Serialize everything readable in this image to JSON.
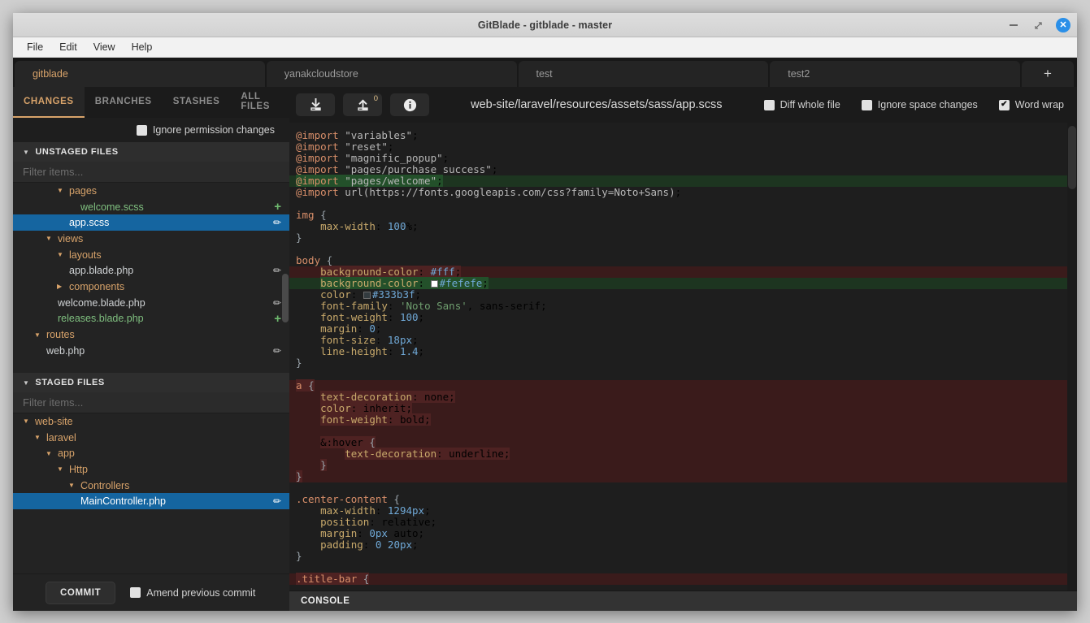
{
  "window": {
    "title": "GitBlade - gitblade - master",
    "minimize_label": "–",
    "maximize_label": "⤢",
    "close_label": "✕"
  },
  "menubar": {
    "items": [
      "File",
      "Edit",
      "View",
      "Help"
    ]
  },
  "repo_tabs": {
    "items": [
      {
        "label": "gitblade",
        "active": true
      },
      {
        "label": "yanakcloudstore",
        "active": false
      },
      {
        "label": "test",
        "active": false
      },
      {
        "label": "test2",
        "active": false
      }
    ],
    "add_label": "+"
  },
  "left_panel": {
    "tabs": [
      {
        "label": "CHANGES",
        "active": true
      },
      {
        "label": "BRANCHES",
        "active": false
      },
      {
        "label": "STASHES",
        "active": false
      },
      {
        "label": "ALL FILES",
        "active": false
      }
    ],
    "ignore_permission": {
      "label": "Ignore permission changes",
      "checked": false,
      "mark": ""
    },
    "unstaged": {
      "header": "UNSTAGED FILES",
      "filter_placeholder": "Filter items...",
      "rows": [
        {
          "label": "pages",
          "indent": 3,
          "type": "dir",
          "caret": "▾",
          "action": ""
        },
        {
          "label": "welcome.scss",
          "indent": 4,
          "type": "added",
          "caret": "",
          "action": "+"
        },
        {
          "label": "app.scss",
          "indent": 3,
          "type": "selected",
          "caret": "",
          "action": "✏"
        },
        {
          "label": "views",
          "indent": 2,
          "type": "dir",
          "caret": "▾",
          "action": ""
        },
        {
          "label": "layouts",
          "indent": 3,
          "type": "dir",
          "caret": "▾",
          "action": ""
        },
        {
          "label": "app.blade.php",
          "indent": 3,
          "type": "file",
          "caret": "",
          "action": "✏"
        },
        {
          "label": "components",
          "indent": 3,
          "type": "dir",
          "caret": "▸",
          "action": ""
        },
        {
          "label": "welcome.blade.php",
          "indent": 2,
          "type": "file",
          "caret": "",
          "action": "✏"
        },
        {
          "label": "releases.blade.php",
          "indent": 2,
          "type": "added",
          "caret": "",
          "action": "+"
        },
        {
          "label": "routes",
          "indent": 1,
          "type": "dir",
          "caret": "▾",
          "action": ""
        },
        {
          "label": "web.php",
          "indent": 1,
          "type": "file",
          "caret": "",
          "action": "✏"
        }
      ]
    },
    "staged": {
      "header": "STAGED FILES",
      "filter_placeholder": "Filter items...",
      "rows": [
        {
          "label": "web-site",
          "indent": 0,
          "type": "dir",
          "caret": "▾",
          "action": ""
        },
        {
          "label": "laravel",
          "indent": 1,
          "type": "dir",
          "caret": "▾",
          "action": ""
        },
        {
          "label": "app",
          "indent": 2,
          "type": "dir",
          "caret": "▾",
          "action": ""
        },
        {
          "label": "Http",
          "indent": 3,
          "type": "dir",
          "caret": "▾",
          "action": ""
        },
        {
          "label": "Controllers",
          "indent": 4,
          "type": "dir",
          "caret": "▾",
          "action": ""
        },
        {
          "label": "MainController.php",
          "indent": 4,
          "type": "selected",
          "caret": "",
          "action": "✏"
        }
      ]
    },
    "commit_button": "COMMIT",
    "amend": {
      "label": "Amend previous commit",
      "checked": false,
      "mark": ""
    }
  },
  "diff_toolbar": {
    "pull_icon": "pull-icon",
    "push_icon": "push-icon",
    "push_count": "0",
    "info_icon": "info-icon",
    "file_path": "web-site/laravel/resources/assets/sass/app.scss",
    "options": [
      {
        "label": "Diff whole file",
        "checked": false,
        "mark": ""
      },
      {
        "label": "Ignore space changes",
        "checked": false,
        "mark": ""
      },
      {
        "label": "Word wrap",
        "checked": true,
        "mark": "✔"
      }
    ]
  },
  "console": {
    "label": "CONSOLE"
  },
  "diff": {
    "colors": {
      "added_line": "#1d3520",
      "deleted_line": "#3a1b1b",
      "added_seg": "#23502a",
      "deleted_seg": "#4e2222",
      "selection": "#1565a0",
      "accent": "#d8a36a"
    },
    "lines": [
      {
        "state": "ctx",
        "text": "@import \"variables\";"
      },
      {
        "state": "ctx",
        "text": "@import \"reset\";"
      },
      {
        "state": "ctx",
        "text": "@import \"magnific_popup\";"
      },
      {
        "state": "ctx",
        "text": "@import \"pages/purchase_success\";"
      },
      {
        "state": "add",
        "text": "@import \"pages/welcome\";"
      },
      {
        "state": "ctx",
        "text": "@import url(https://fonts.googleapis.com/css?family=Noto+Sans);"
      },
      {
        "state": "ctx",
        "text": ""
      },
      {
        "state": "ctx",
        "text": "img {"
      },
      {
        "state": "ctx",
        "text": "    max-width: 100%;"
      },
      {
        "state": "ctx",
        "text": "}"
      },
      {
        "state": "ctx",
        "text": ""
      },
      {
        "state": "ctx",
        "text": "body {"
      },
      {
        "state": "del",
        "text": "    background-color: #fff;"
      },
      {
        "state": "add",
        "text": "    background-color: #fefefe;"
      },
      {
        "state": "ctx",
        "text": "    color: #333b3f;"
      },
      {
        "state": "ctx",
        "text": "    font-family: 'Noto Sans', sans-serif;"
      },
      {
        "state": "ctx",
        "text": "    font-weight: 100;"
      },
      {
        "state": "ctx",
        "text": "    margin: 0;"
      },
      {
        "state": "ctx",
        "text": "    font-size: 18px;"
      },
      {
        "state": "ctx",
        "text": "    line-height: 1.4;"
      },
      {
        "state": "ctx",
        "text": "}"
      },
      {
        "state": "ctx",
        "text": ""
      },
      {
        "state": "del",
        "text": "a {"
      },
      {
        "state": "del",
        "text": "    text-decoration: none;"
      },
      {
        "state": "del",
        "text": "    color: inherit;"
      },
      {
        "state": "del",
        "text": "    font-weight: bold;"
      },
      {
        "state": "del",
        "text": ""
      },
      {
        "state": "del",
        "text": "    &:hover {"
      },
      {
        "state": "del",
        "text": "        text-decoration: underline;"
      },
      {
        "state": "del",
        "text": "    }"
      },
      {
        "state": "del",
        "text": "}"
      },
      {
        "state": "ctx",
        "text": ""
      },
      {
        "state": "ctx",
        "text": ".center-content {"
      },
      {
        "state": "ctx",
        "text": "    max-width: 1294px;"
      },
      {
        "state": "ctx",
        "text": "    position: relative;"
      },
      {
        "state": "ctx",
        "text": "    margin: 0px auto;"
      },
      {
        "state": "ctx",
        "text": "    padding: 0 20px;"
      },
      {
        "state": "ctx",
        "text": "}"
      },
      {
        "state": "ctx",
        "text": ""
      },
      {
        "state": "del",
        "text": ".title-bar {"
      }
    ]
  }
}
